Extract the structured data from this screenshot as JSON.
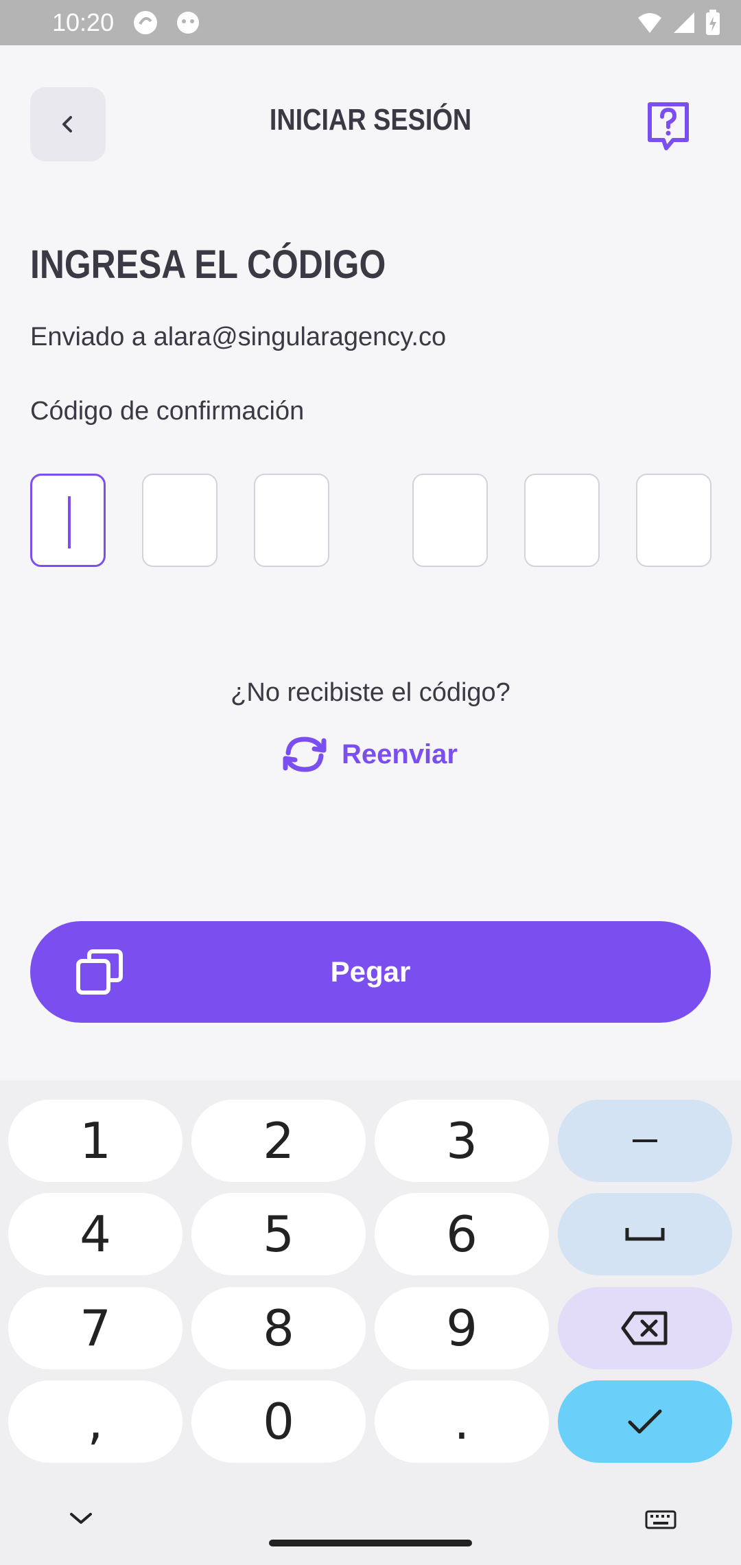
{
  "status_bar": {
    "time": "10:20"
  },
  "header": {
    "title": "INICIAR SESIÓN"
  },
  "page": {
    "title": "INGRESA EL CÓDIGO",
    "sent_to": "Enviado a alara@singularagency.co",
    "code_label": "Código de confirmación",
    "no_code": "¿No recibiste el código?",
    "resend_label": "Reenviar",
    "paste_label": "Pegar"
  },
  "colors": {
    "accent": "#7b4ef0",
    "background": "#f6f5f7",
    "text": "#3a3944"
  },
  "keyboard": {
    "keys": [
      "1",
      "2",
      "3",
      "–",
      "4",
      "5",
      "6",
      "␣",
      "7",
      "8",
      "9",
      "⌫",
      ",",
      "0",
      ".",
      "✓"
    ]
  }
}
